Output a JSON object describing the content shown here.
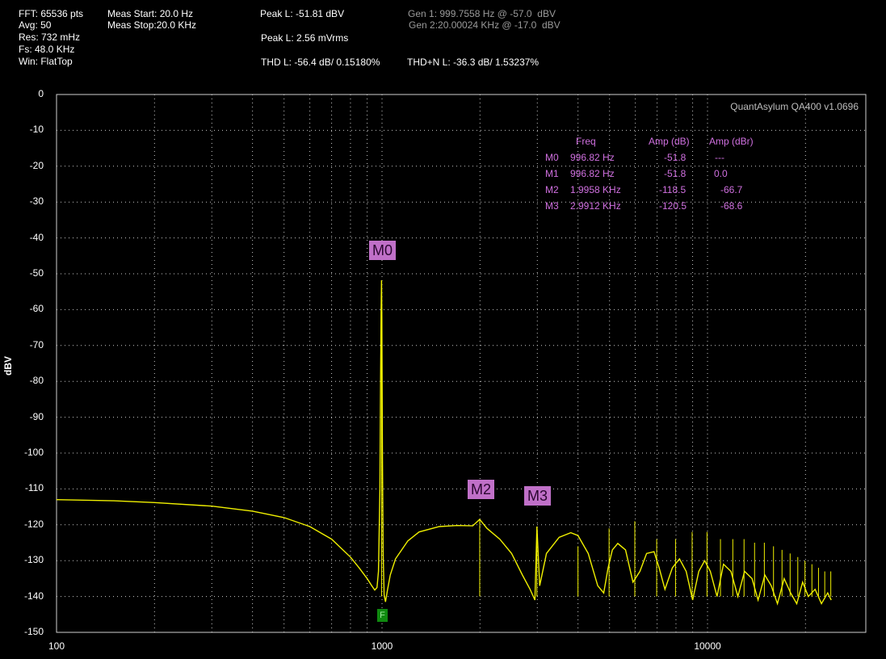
{
  "header": {
    "fft": "FFT: 65536 pts",
    "avg": "Avg: 50",
    "res": "Res: 732 mHz",
    "fs": "Fs: 48.0 KHz",
    "win": "Win: FlatTop",
    "meas_start": "Meas Start: 20.0 Hz",
    "meas_stop": "Meas Stop:20.0 KHz",
    "peak_l_dbv": "Peak L: -51.81 dBV",
    "peak_l_mvrms": "Peak L: 2.56 mVrms",
    "thd_l": "THD L: -56.4 dB/ 0.15180%",
    "thdn_l": "THD+N L: -36.3 dB/ 1.53237%",
    "gen1": "Gen 1: 999.7558 Hz @ -57.0  dBV",
    "gen2": "Gen 2:20.00024 KHz @ -17.0  dBV"
  },
  "brand": "QuantAsylum QA400 v1.0696",
  "y_axis_label": "dBV",
  "y_ticks": [
    "0",
    "-10",
    "-20",
    "-30",
    "-40",
    "-50",
    "-60",
    "-70",
    "-80",
    "-90",
    "-100",
    "-110",
    "-120",
    "-130",
    "-140",
    "-150"
  ],
  "x_ticks": [
    "100",
    "1000",
    "10000"
  ],
  "marker_table": {
    "headers": [
      "Freq",
      "Amp (dB)",
      "Amp (dBr)"
    ],
    "rows": [
      {
        "name": "M0",
        "freq": "996.82 Hz",
        "amp": "-51.8",
        "ampr": "---"
      },
      {
        "name": "M1",
        "freq": "996.82 Hz",
        "amp": "-51.8",
        "ampr": "0.0"
      },
      {
        "name": "M2",
        "freq": "1.9958 KHz",
        "amp": "-118.5",
        "ampr": "-66.7"
      },
      {
        "name": "M3",
        "freq": "2.9912 KHz",
        "amp": "-120.5",
        "ampr": "-68.6"
      }
    ]
  },
  "marker_labels": [
    "M0",
    "M2",
    "M3"
  ],
  "f_marker": "F",
  "colors": {
    "trace": "#f0f000",
    "grid": "#c8c8c8",
    "marker": "#c070c8",
    "marker_text": "#d070e0",
    "f_marker": "#0f8a0f"
  },
  "chart_data": {
    "type": "line",
    "xscale": "log",
    "xlim": [
      100,
      25000
    ],
    "ylim": [
      -150,
      0
    ],
    "ylabel": "dBV",
    "grid": true,
    "series": [
      {
        "x": [
          100,
          150,
          200,
          300,
          400,
          500,
          600,
          700,
          800,
          850,
          900,
          930,
          950,
          965,
          975,
          985,
          990,
          994,
          996.82,
          999,
          1003,
          1008,
          1015,
          1025,
          1040,
          1060,
          1100,
          1200,
          1300,
          1500,
          1700,
          1900,
          1995.8,
          2100,
          2300,
          2500,
          2700,
          2850,
          2950,
          2991.2,
          3050,
          3200,
          3500,
          3800,
          4000,
          4300,
          4600,
          4800,
          4950,
          5100,
          5300,
          5600,
          5900,
          6200,
          6500,
          6850,
          7100,
          7400,
          7800,
          8200,
          8600,
          9000,
          9400,
          9800,
          10200,
          10700,
          11200,
          11800,
          12400,
          13000,
          13700,
          14300,
          15000,
          15700,
          16400,
          17200,
          18000,
          18800,
          19600,
          20400,
          21400,
          22400,
          23400,
          24000
        ],
        "y": [
          -113,
          -113.3,
          -113.8,
          -114.8,
          -116.2,
          -118,
          -120.5,
          -124,
          -129,
          -132,
          -135,
          -137,
          -138.2,
          -137.5,
          -133,
          -110,
          -80,
          -60,
          -51.8,
          -62,
          -100,
          -128,
          -139.5,
          -141.5,
          -138,
          -134,
          -129.5,
          -124.5,
          -122,
          -120.5,
          -120.2,
          -120.3,
          -118.5,
          -121,
          -124,
          -128,
          -134,
          -138,
          -141,
          -120.5,
          -137,
          -128,
          -123.5,
          -122.2,
          -123,
          -128,
          -137,
          -139,
          -132,
          -127,
          -125.2,
          -127,
          -136,
          -133,
          -128,
          -127.5,
          -132,
          -138,
          -132,
          -129.5,
          -133,
          -141,
          -133,
          -130,
          -133,
          -140,
          -131,
          -133,
          -140,
          -133,
          -135,
          -141,
          -134,
          -137,
          -142,
          -135,
          -139,
          -142,
          -136,
          -140,
          -138,
          -142,
          -139,
          -141
        ]
      }
    ],
    "spurs": [
      {
        "x": 996.82,
        "y": -51.8
      },
      {
        "x": 1995.8,
        "y": -118.5
      },
      {
        "x": 2991.2,
        "y": -120.5
      },
      {
        "x": 4000,
        "y": -126
      },
      {
        "x": 4985,
        "y": -121
      },
      {
        "x": 5980,
        "y": -119
      },
      {
        "x": 6980,
        "y": -124
      },
      {
        "x": 7975,
        "y": -124
      },
      {
        "x": 8970,
        "y": -122
      },
      {
        "x": 9965,
        "y": -122
      },
      {
        "x": 10960,
        "y": -124
      },
      {
        "x": 11960,
        "y": -124
      },
      {
        "x": 12950,
        "y": -124
      },
      {
        "x": 13950,
        "y": -125
      },
      {
        "x": 14950,
        "y": -125
      },
      {
        "x": 15950,
        "y": -126
      },
      {
        "x": 16940,
        "y": -127
      },
      {
        "x": 17940,
        "y": -128
      },
      {
        "x": 18940,
        "y": -129
      },
      {
        "x": 19930,
        "y": -130
      },
      {
        "x": 20930,
        "y": -131
      },
      {
        "x": 21930,
        "y": -132
      },
      {
        "x": 22920,
        "y": -133
      },
      {
        "x": 23920,
        "y": -133
      }
    ]
  }
}
